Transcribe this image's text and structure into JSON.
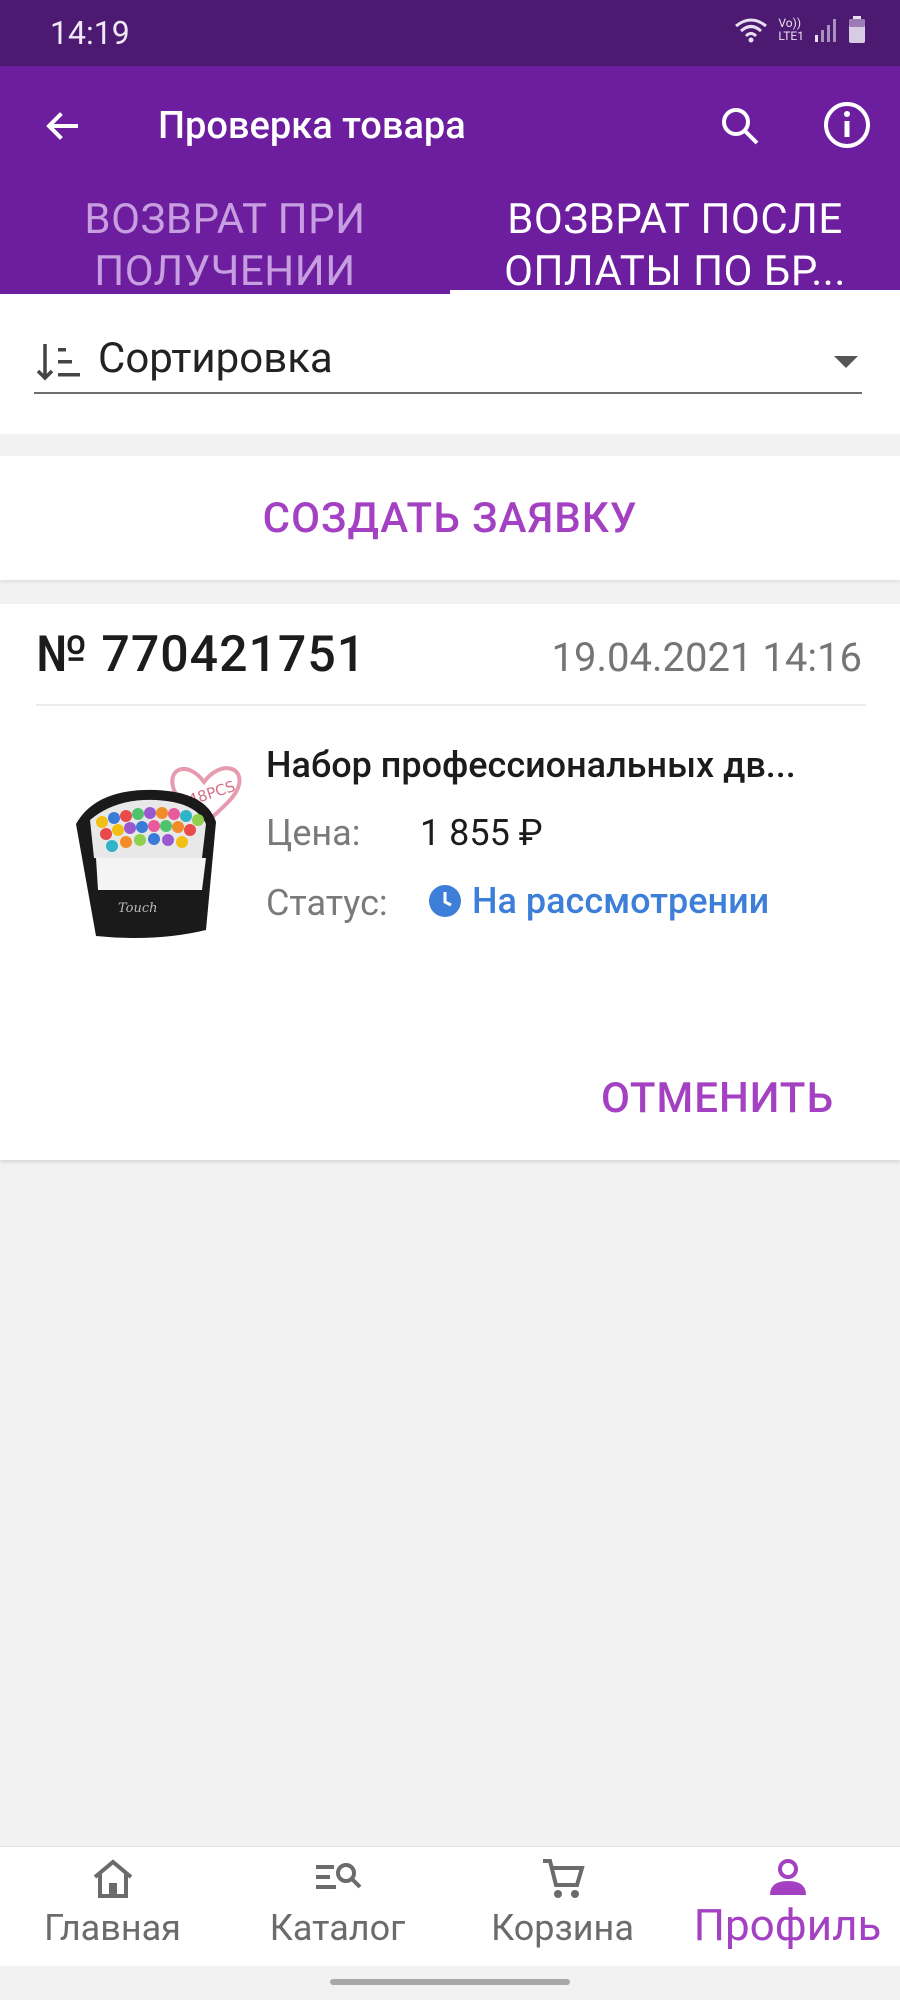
{
  "status_bar": {
    "time": "14:19",
    "net_label_top": "Vo))",
    "net_label_bottom": "LTE1"
  },
  "app_bar": {
    "title": "Проверка товара"
  },
  "tabs": [
    {
      "label_line1": "ВОЗВРАТ ПРИ",
      "label_line2": "ПОЛУЧЕНИИ",
      "active": false
    },
    {
      "label_line1": "ВОЗВРАТ ПОСЛЕ",
      "label_line2": "ОПЛАТЫ ПО БР...",
      "active": true
    }
  ],
  "sort": {
    "label": "Сортировка"
  },
  "create_button": {
    "label": "СОЗДАТЬ ЗАЯВКУ"
  },
  "order": {
    "number": "№ 770421751",
    "datetime": "19.04.2021 14:16",
    "product_name": "Набор профессиональных дв...",
    "price_label": "Цена:",
    "price_value": "1 855 ₽",
    "status_label": "Статус:",
    "status_value": "На рассмотрении",
    "image_badge": "48PCS",
    "cancel_label": "ОТМЕНИТЬ"
  },
  "bottom_nav": [
    {
      "label": "Главная",
      "icon": "home-icon",
      "active": false
    },
    {
      "label": "Каталог",
      "icon": "catalog-search-icon",
      "active": false
    },
    {
      "label": "Корзина",
      "icon": "cart-icon",
      "active": false
    },
    {
      "label": "Профиль",
      "icon": "profile-icon",
      "active": true
    }
  ],
  "colors": {
    "primary": "#6c1e9e",
    "status_bar": "#4d1a72",
    "accent": "#a441c2",
    "status_blue": "#3d7fd8"
  }
}
